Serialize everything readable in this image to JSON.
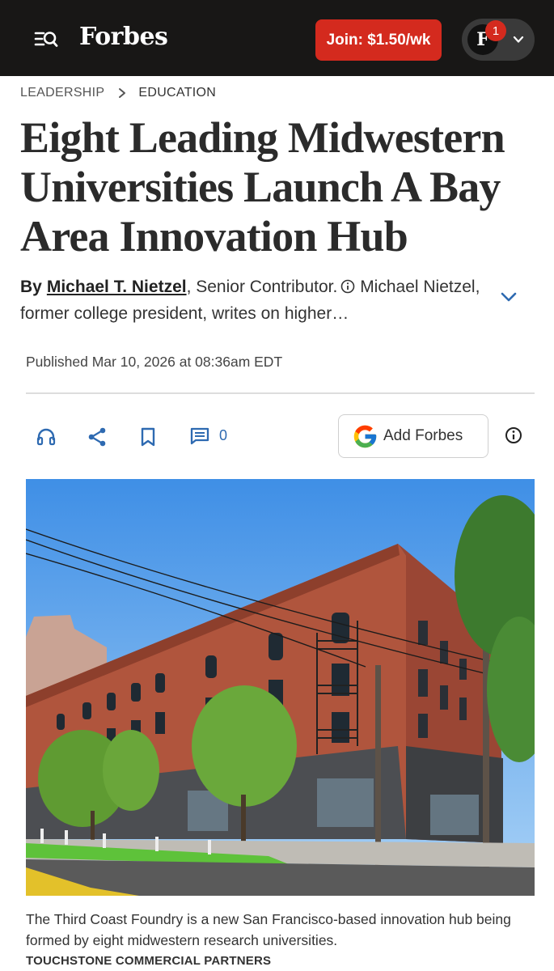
{
  "header": {
    "logo": "Forbes",
    "join_button": "Join: $1.50/wk",
    "account_initial": "F",
    "notification_count": "1"
  },
  "breadcrumb": {
    "section": "LEADERSHIP",
    "subsection": "EDUCATION"
  },
  "article": {
    "title": "Eight Leading Midwestern Universities Launch A Bay Area Innovation Hub",
    "byline_prefix": "By",
    "author": "Michael T. Nietzel",
    "author_role": ", Senior Contributor.",
    "author_bio": "Michael Nietzel, former college president, writes on higher…",
    "published": "Published Mar 10, 2026 at 08:36am EDT"
  },
  "actions": {
    "comment_count": "0",
    "add_forbes_label": "Add Forbes"
  },
  "photo": {
    "caption": "The Third Coast Foundry is a new San Francisco-based innovation hub being formed by eight midwestern research universities.",
    "credit": "TOUCHSTONE COMMERCIAL PARTNERS"
  },
  "colors": {
    "header_bg": "#181716",
    "join_button_bg": "#d42a1e",
    "action_icon": "#2e6ab1"
  },
  "icons": [
    "menu-search-icon",
    "chevron-right-icon",
    "chevron-down-icon",
    "info-icon",
    "headphones-icon",
    "share-icon",
    "bookmark-icon",
    "comment-icon",
    "google-g-icon"
  ]
}
